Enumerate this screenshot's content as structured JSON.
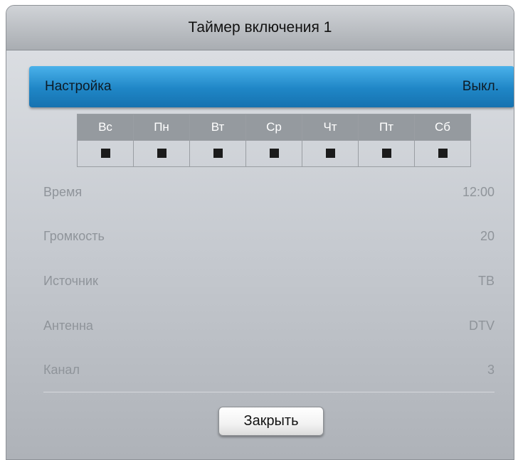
{
  "dialog": {
    "title": "Таймер включения 1"
  },
  "setting": {
    "label": "Настройка",
    "value": "Выкл."
  },
  "days": [
    {
      "label": "Вс",
      "checked": true
    },
    {
      "label": "Пн",
      "checked": true
    },
    {
      "label": "Вт",
      "checked": true
    },
    {
      "label": "Ср",
      "checked": true
    },
    {
      "label": "Чт",
      "checked": true
    },
    {
      "label": "Пт",
      "checked": true
    },
    {
      "label": "Сб",
      "checked": true
    }
  ],
  "rows": [
    {
      "label": "Время",
      "value": "12:00"
    },
    {
      "label": "Громкость",
      "value": "20"
    },
    {
      "label": "Источник",
      "value": "ТВ"
    },
    {
      "label": "Антенна",
      "value": "DTV"
    },
    {
      "label": "Канал",
      "value": "3"
    }
  ],
  "close_label": "Закрыть",
  "colors": {
    "highlight": "#1f86c6",
    "day_header": "#959a9f",
    "disabled_text": "#8f949a"
  }
}
